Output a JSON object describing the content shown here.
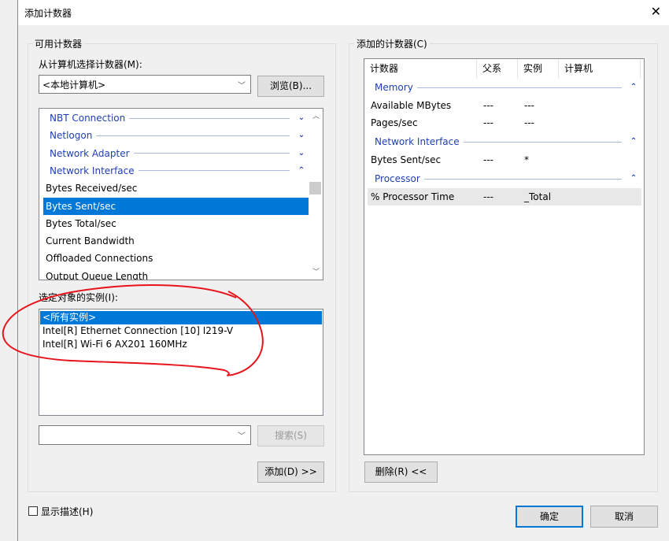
{
  "window": {
    "title": "添加计数器",
    "close_icon": "close-icon"
  },
  "available": {
    "group_label": "可用计数器",
    "computer_label": "从计算机选择计数器(M):",
    "computer_value": "<本地计算机>",
    "browse_label": "浏览(B)...",
    "counters": [
      {
        "label": "NBT Connection",
        "type": "category",
        "expanded": false
      },
      {
        "label": "Netlogon",
        "type": "category",
        "expanded": false
      },
      {
        "label": "Network Adapter",
        "type": "category",
        "expanded": false
      },
      {
        "label": "Network Interface",
        "type": "category",
        "expanded": true
      },
      {
        "label": "Bytes Received/sec",
        "type": "item"
      },
      {
        "label": "Bytes Sent/sec",
        "type": "item",
        "selected": true
      },
      {
        "label": "Bytes Total/sec",
        "type": "item"
      },
      {
        "label": "Current Bandwidth",
        "type": "item"
      },
      {
        "label": "Offloaded Connections",
        "type": "item"
      },
      {
        "label": "Output Queue Length",
        "type": "item"
      }
    ],
    "instances_label": "选定对象的实例(I):",
    "instances": [
      "<所有实例>",
      "Intel[R] Ethernet Connection [10] I219-V",
      "Intel[R] Wi-Fi 6 AX201 160MHz"
    ],
    "search_value": "",
    "search_label": "搜索(S)",
    "add_label": "添加(D) >>"
  },
  "added": {
    "group_label": "添加的计数器(C)",
    "columns": [
      "计数器",
      "父系",
      "实例",
      "计算机"
    ],
    "groups": [
      {
        "name": "Memory",
        "rows": [
          [
            "Available MBytes",
            "---",
            "---",
            ""
          ],
          [
            "Pages/sec",
            "---",
            "---",
            ""
          ]
        ]
      },
      {
        "name": "Network Interface",
        "rows": [
          [
            "Bytes Sent/sec",
            "---",
            "*",
            ""
          ]
        ]
      },
      {
        "name": "Processor",
        "rows": [
          [
            "% Processor Time",
            "---",
            "_Total",
            ""
          ]
        ]
      }
    ],
    "remove_label": "删除(R) <<"
  },
  "footer": {
    "show_desc_label": "显示描述(H)",
    "show_desc_checked": false,
    "ok_label": "确定",
    "cancel_label": "取消"
  },
  "colors": {
    "accent": "#0078d7",
    "category": "#1e3eb4",
    "annotation": "#e8141c"
  }
}
